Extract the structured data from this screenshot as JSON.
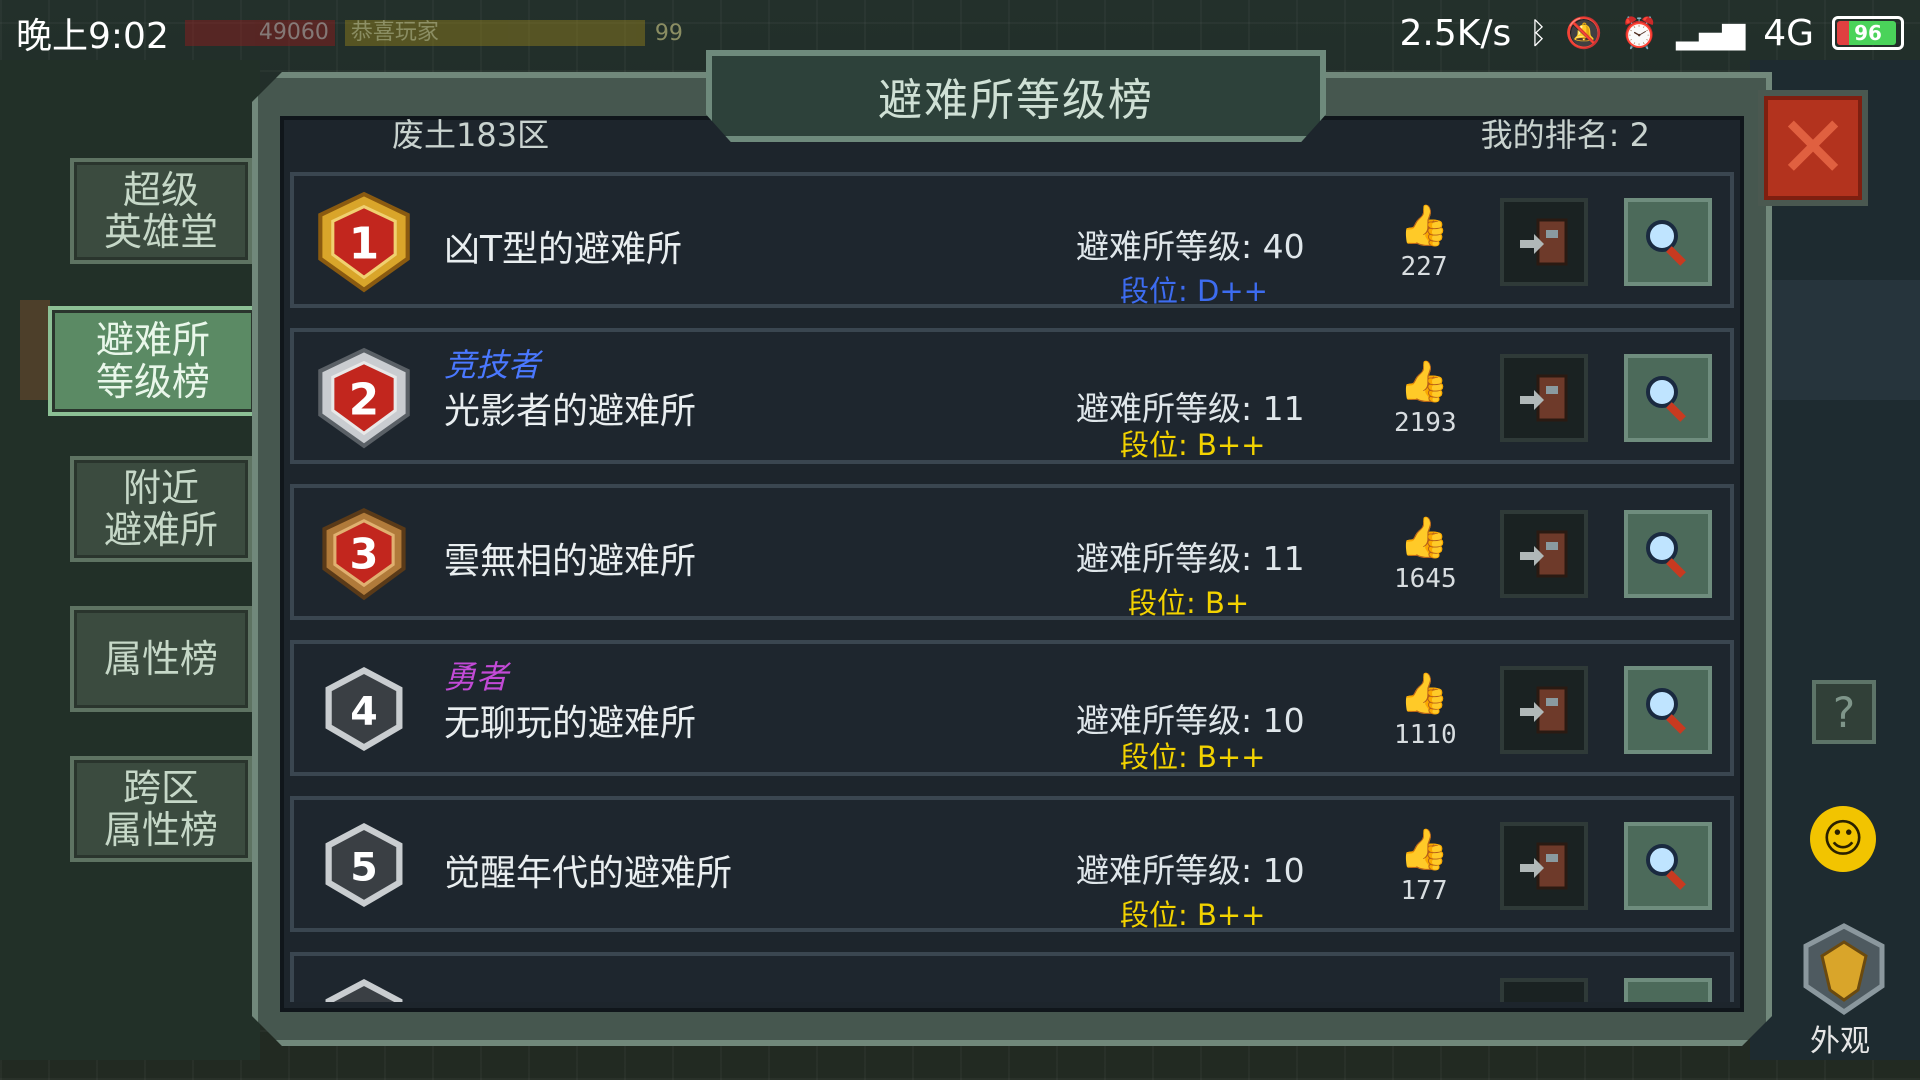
{
  "status_bar": {
    "time": "晚上9:02",
    "hp_value": "49060",
    "xp_level": "99",
    "ghost_text": "恭喜玩家",
    "net_speed": "2.5K/s",
    "network": "4G",
    "battery": "96"
  },
  "side_menu": [
    {
      "label": "超级\n英雄堂",
      "active": false
    },
    {
      "label": "避难所\n等级榜",
      "active": true
    },
    {
      "label": "附近\n避难所",
      "active": false
    },
    {
      "label": "属性榜",
      "active": false
    },
    {
      "label": "跨区\n属性榜",
      "active": false
    }
  ],
  "panel": {
    "title": "避难所等级榜",
    "region": "废土183区",
    "my_rank": "我的排名: 2"
  },
  "rows": [
    {
      "rank": "1",
      "title": "",
      "title_color": "",
      "name": "凶T型的避难所",
      "level": "避难所等级: 40",
      "tier": "段位: D++",
      "tier_color": "#3d6cf0",
      "likes": "227"
    },
    {
      "rank": "2",
      "title": "竞技者",
      "title_color": "#4a78ff",
      "name": "光影者的避难所",
      "level": "避难所等级: 11",
      "tier": "段位: B++",
      "tier_color": "#f2d200",
      "likes": "2193"
    },
    {
      "rank": "3",
      "title": "",
      "title_color": "",
      "name": "雲無相的避难所",
      "level": "避难所等级: 11",
      "tier": "段位: B+",
      "tier_color": "#f2d200",
      "likes": "1645"
    },
    {
      "rank": "4",
      "title": "勇者",
      "title_color": "#c24ad6",
      "name": "无聊玩的避难所",
      "level": "避难所等级: 10",
      "tier": "段位: B++",
      "tier_color": "#f2d200",
      "likes": "1110"
    },
    {
      "rank": "5",
      "title": "",
      "title_color": "",
      "name": "觉醒年代的避难所",
      "level": "避难所等级: 10",
      "tier": "段位: B++",
      "tier_color": "#f2d200",
      "likes": "177"
    }
  ],
  "right_side": {
    "help_symbol": "?",
    "appearance_label": "外观"
  },
  "colors": {
    "tier_blue": "#3d6cf0",
    "tier_yellow": "#f2d200",
    "close_red": "#b3331e"
  }
}
